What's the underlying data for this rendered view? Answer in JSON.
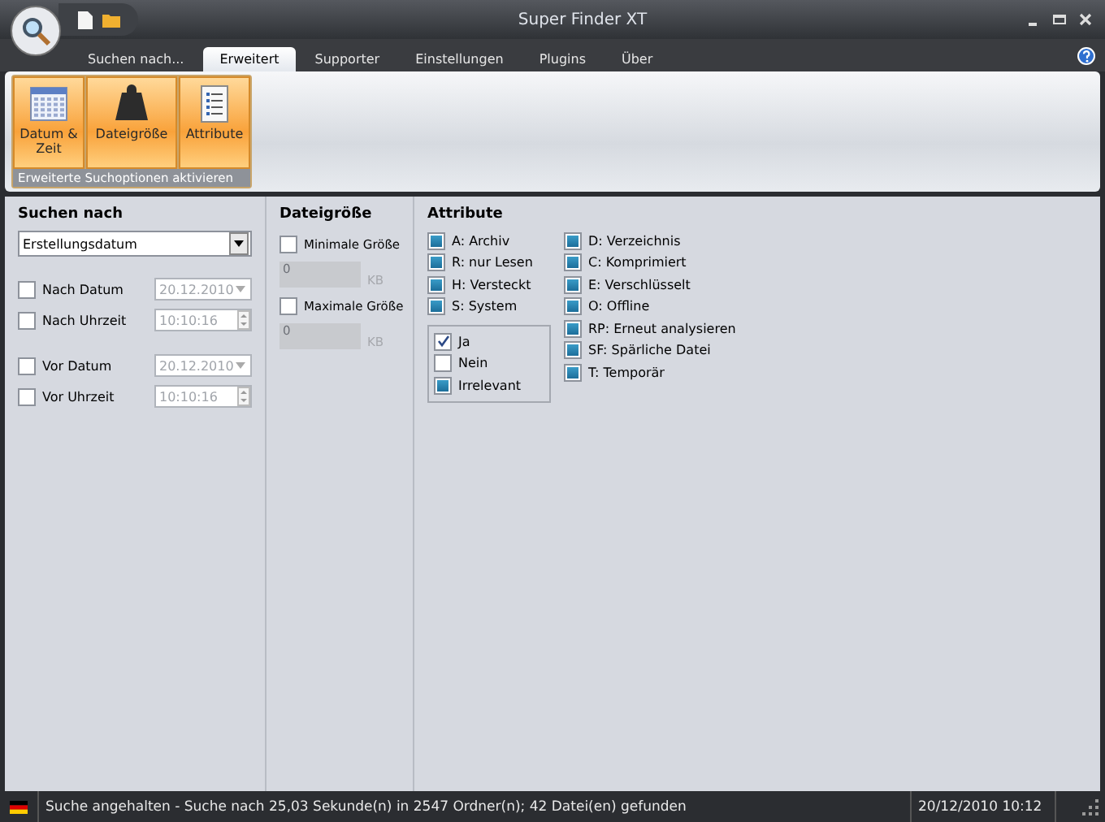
{
  "window": {
    "title": "Super Finder XT"
  },
  "tabs": [
    {
      "label": "Suchen nach...",
      "selected": false
    },
    {
      "label": "Erweitert",
      "selected": true
    },
    {
      "label": "Supporter",
      "selected": false
    },
    {
      "label": "Einstellungen",
      "selected": false
    },
    {
      "label": "Plugins",
      "selected": false
    },
    {
      "label": "Über",
      "selected": false
    }
  ],
  "ribbon": {
    "group_label": "Erweiterte Suchoptionen aktivieren",
    "buttons": [
      {
        "label": "Datum & Zeit",
        "kind": "calendar"
      },
      {
        "label": "Dateigröße",
        "kind": "weight"
      },
      {
        "label": "Attribute",
        "kind": "list"
      }
    ]
  },
  "search_by": {
    "title": "Suchen nach",
    "dropdown": "Erstellungsdatum",
    "rows": [
      {
        "label": "Nach Datum",
        "checked": false,
        "value": "20.12.2010",
        "kind": "date"
      },
      {
        "label": "Nach Uhrzeit",
        "checked": false,
        "value": "10:10:16",
        "kind": "time"
      },
      {
        "label": "Vor Datum",
        "checked": false,
        "value": "20.12.2010",
        "kind": "date"
      },
      {
        "label": "Vor Uhrzeit",
        "checked": false,
        "value": "10:10:16",
        "kind": "time"
      }
    ]
  },
  "file_size": {
    "title": "Dateigröße",
    "rows": [
      {
        "label": "Minimale Größe",
        "checked": false,
        "value": "0",
        "unit": "KB"
      },
      {
        "label": "Maximale Größe",
        "checked": false,
        "value": "0",
        "unit": "KB"
      }
    ]
  },
  "attributes": {
    "title": "Attribute",
    "column_1": [
      {
        "label": "A: Archiv",
        "checked": false,
        "indeterminate": true
      },
      {
        "label": "R: nur Lesen",
        "checked": false,
        "indeterminate": true
      },
      {
        "label": "H: Versteckt",
        "checked": false,
        "indeterminate": true
      },
      {
        "label": "S: System",
        "checked": false,
        "indeterminate": true
      }
    ],
    "legend": [
      {
        "label": "Ja",
        "checked": true,
        "indeterminate": false
      },
      {
        "label": "Nein",
        "checked": false,
        "indeterminate": false
      },
      {
        "label": "Irrelevant",
        "checked": false,
        "indeterminate": true
      }
    ],
    "column_2": [
      {
        "label": "D: Verzeichnis",
        "checked": false,
        "indeterminate": true
      },
      {
        "label": "C: Komprimiert",
        "checked": false,
        "indeterminate": true
      },
      {
        "label": "E: Verschlüsselt",
        "checked": false,
        "indeterminate": true
      },
      {
        "label": "O: Offline",
        "checked": false,
        "indeterminate": true
      },
      {
        "label": "RP: Erneut analysieren",
        "checked": false,
        "indeterminate": true
      },
      {
        "label": "SF: Spärliche Datei",
        "checked": false,
        "indeterminate": true
      },
      {
        "label": "T: Temporär",
        "checked": false,
        "indeterminate": true
      }
    ]
  },
  "status_bar": {
    "message": "Suche angehalten - Suche nach 25,03 Sekunde(n) in 2547 Ordner(n); 42 Datei(en) gefunden",
    "datetime": "20/12/2010 10:12"
  }
}
